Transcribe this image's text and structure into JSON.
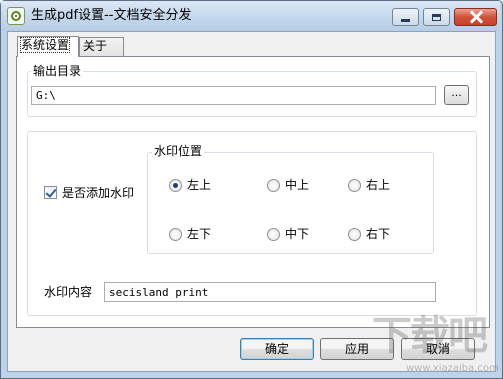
{
  "window": {
    "title": "生成pdf设置--文档安全分发",
    "icon": "shield-app-icon"
  },
  "tabs": [
    {
      "label": "系统设置",
      "active": true
    },
    {
      "label": "关于",
      "active": false
    }
  ],
  "output": {
    "group_label": "输出目录",
    "path_value": "G:\\",
    "browse_label": "..."
  },
  "watermark": {
    "add_label": "是否添加水印",
    "add_checked": true,
    "position_group_label": "水印位置",
    "positions": [
      {
        "label": "左上",
        "checked": true
      },
      {
        "label": "中上",
        "checked": false
      },
      {
        "label": "右上",
        "checked": false
      },
      {
        "label": "左下",
        "checked": false
      },
      {
        "label": "中下",
        "checked": false
      },
      {
        "label": "右下",
        "checked": false
      }
    ],
    "content_label": "水印内容",
    "content_value": "secisland print"
  },
  "buttons": {
    "ok": "确定",
    "apply": "应用",
    "cancel": "取消"
  },
  "site_watermark": {
    "logo_text": "下载吧",
    "url": "www.xiazaiba.com"
  },
  "colors": {
    "titlebar": "#c3d7ec",
    "close_button": "#c7422c",
    "default_button_border": "#3c7fb1"
  }
}
